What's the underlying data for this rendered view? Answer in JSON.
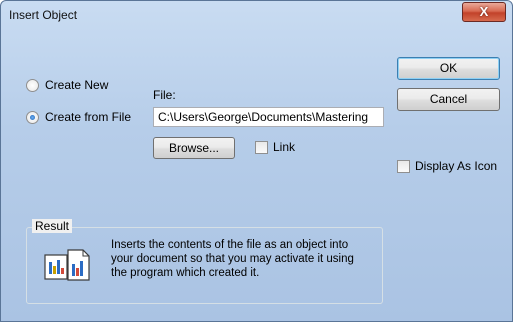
{
  "window": {
    "title": "Insert Object",
    "close_label": "X"
  },
  "options": {
    "create_new_label": "Create New",
    "create_from_file_label": "Create from File",
    "selected": "create_from_file"
  },
  "file": {
    "label": "File:",
    "value": "C:\\Users\\George\\Documents\\Mastering"
  },
  "buttons": {
    "browse_label": "Browse...",
    "ok_label": "OK",
    "cancel_label": "Cancel"
  },
  "checkboxes": {
    "link_label": "Link",
    "link_checked": false,
    "display_as_icon_label": "Display As Icon",
    "display_as_icon_checked": false
  },
  "result": {
    "label": "Result",
    "text": "Inserts the contents of the file as an object into your document so that you may activate it using the program which created it.",
    "icon": "insert-file-icon"
  }
}
